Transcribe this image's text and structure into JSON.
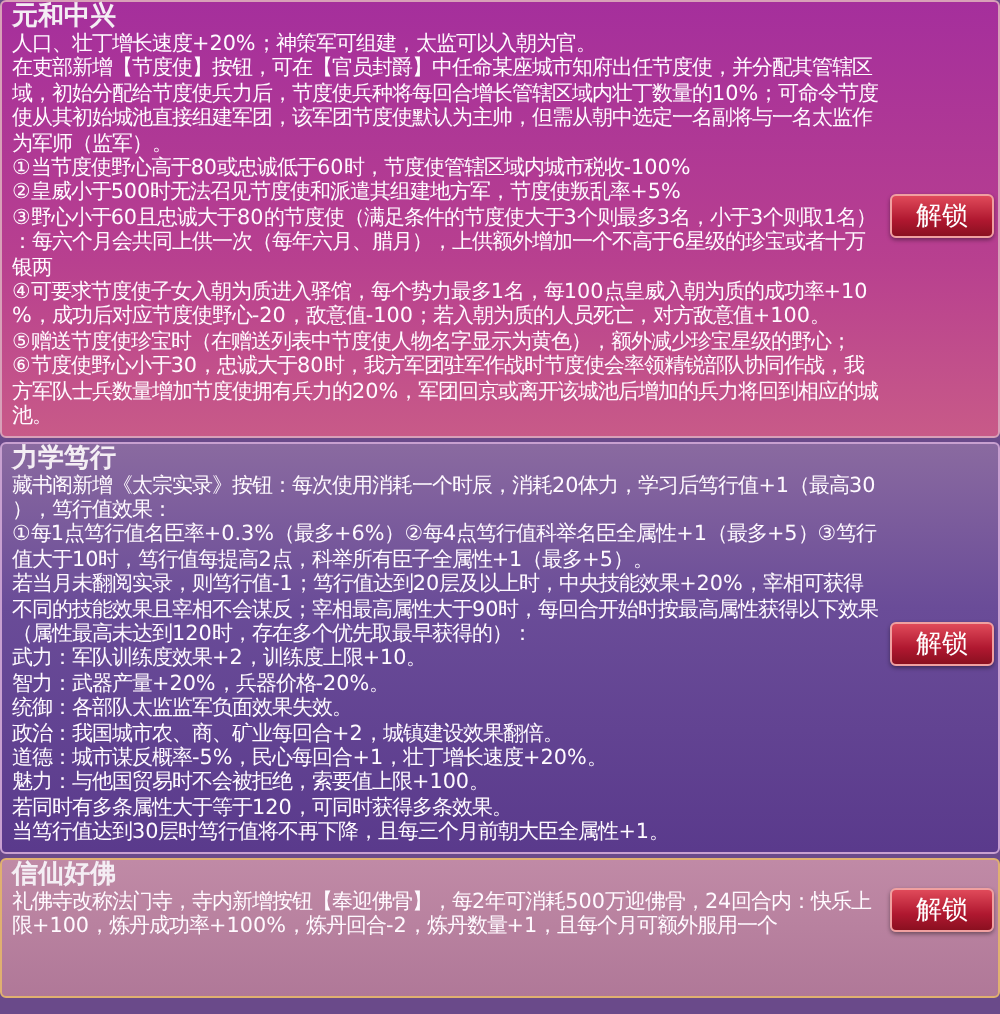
{
  "sections": [
    {
      "title": "元和中兴",
      "button": "解锁",
      "paragraphs": [
        "人口、壮丁增长速度+20%；神策军可组建，太监可以入朝为官。",
        "在吏部新增【节度使】按钮，可在【官员封爵】中任命某座城市知府出任节度使，并分配其管辖区域，初始分配给节度使兵力后，节度使兵种将每回合增长管辖区域内壮丁数量的10%；可命令节度使从其初始城池直接组建军团，该军团节度使默认为主帅，但需从朝中选定一名副将与一名太监作为军师（监军）。",
        "①当节度使野心高于80或忠诚低于60时，节度使管辖区域内城市税收-100%",
        "②皇威小于500时无法召见节度使和派遣其组建地方军，节度使叛乱率+5%",
        "③野心小于60且忠诚大于80的节度使（满足条件的节度使大于3个则最多3名，小于3个则取1名）：每六个月会共同上供一次（每年六月、腊月），上供额外增加一个不高于6星级的珍宝或者十万银两",
        "④可要求节度使子女入朝为质进入驿馆，每个势力最多1名，每100点皇威入朝为质的成功率+10%，成功后对应节度使野心-20，敌意值-100；若入朝为质的人员死亡，对方敌意值+100。",
        "⑤赠送节度使珍宝时（在赠送列表中节度使人物名字显示为黄色），额外减少珍宝星级的野心；",
        "⑥节度使野心小于30，忠诚大于80时，我方军团驻军作战时节度使会率领精锐部队协同作战，我方军队士兵数量增加节度使拥有兵力的20%，军团回京或离开该城池后增加的兵力将回到相应的城池。"
      ]
    },
    {
      "title": "力学笃行",
      "button": "解锁",
      "paragraphs": [
        "藏书阁新增《太宗实录》按钮：每次使用消耗一个时辰，消耗20体力，学习后笃行值+1（最高30），笃行值效果：",
        "①每1点笃行值名臣率+0.3%（最多+6%）②每4点笃行值科举名臣全属性+1（最多+5）③笃行值大于10时，笃行值每提高2点，科举所有臣子全属性+1（最多+5）。",
        "若当月未翻阅实录，则笃行值-1；笃行值达到20层及以上时，中央技能效果+20%，宰相可获得不同的技能效果且宰相不会谋反；宰相最高属性大于90时，每回合开始时按最高属性获得以下效果（属性最高未达到120时，存在多个优先取最早获得的）：",
        "武力：军队训练度效果+2，训练度上限+10。",
        "智力：武器产量+20%，兵器价格-20%。",
        "统御：各部队太监监军负面效果失效。",
        "政治：我国城市农、商、矿业每回合+2，城镇建设效果翻倍。",
        "道德：城市谋反概率-5%，民心每回合+1，壮丁增长速度+20%。",
        "魅力：与他国贸易时不会被拒绝，索要值上限+100。",
        "若同时有多条属性大于等于120，可同时获得多条效果。",
        "当笃行值达到30层时笃行值将不再下降，且每三个月前朝大臣全属性+1。"
      ]
    },
    {
      "title": "信仙好佛",
      "button": "解锁",
      "paragraphs": [
        "礼佛寺改称法门寺，寺内新增按钮【奉迎佛骨】，每2年可消耗500万迎佛骨，24回合内：快乐上限+100，炼丹成功率+100%，炼丹回合-2，炼丹数量+1，且每个月可额外服用一个"
      ]
    }
  ]
}
